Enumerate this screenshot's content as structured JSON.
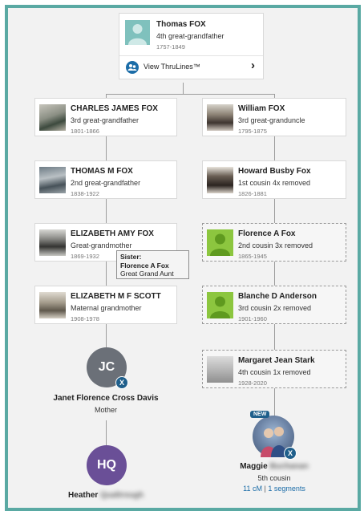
{
  "top": {
    "name": "Thomas FOX",
    "relation": "4th great-grandfather",
    "dates": "1757-1849",
    "thrulines_label": "View ThruLines™",
    "chevron": "›"
  },
  "left": [
    {
      "name": "CHARLES JAMES FOX",
      "relation": "3rd great-grandfather",
      "dates": "1801-1866"
    },
    {
      "name": "THOMAS M FOX",
      "relation": "2nd great-grandfather",
      "dates": "1838-1922"
    },
    {
      "name": "ELIZABETH AMY FOX",
      "relation": "Great-grandmother",
      "dates": "1869-1932"
    },
    {
      "name": "ELIZABETH M F SCOTT",
      "relation": "Maternal grandmother",
      "dates": "1908-1978"
    }
  ],
  "right": [
    {
      "name": "William FOX",
      "relation": "3rd great-granduncle",
      "dates": "1795-1875"
    },
    {
      "name": "Howard Busby Fox",
      "relation": "1st cousin 4x removed",
      "dates": "1826-1881"
    },
    {
      "name": "Florence A Fox",
      "relation": "2nd cousin 3x removed",
      "dates": "1865-1945"
    },
    {
      "name": "Blanche D Anderson",
      "relation": "3rd cousin 2x removed",
      "dates": "1901-1960"
    },
    {
      "name": "Margaret Jean Stark",
      "relation": "4th cousin 1x removed",
      "dates": "1928-2020"
    }
  ],
  "sister_tooltip": {
    "title": "Sister:",
    "name": "Florence A Fox",
    "relation": "Great Grand Aunt"
  },
  "mother": {
    "initials": "JC",
    "name": "Janet Florence Cross Davis",
    "relation": "Mother",
    "color": "#6b7078"
  },
  "self": {
    "initials": "HQ",
    "first_name": "Heather",
    "surname": "Qualtrough",
    "color": "#6a4f97"
  },
  "match": {
    "badge": "NEW",
    "first_name": "Maggie",
    "surname": "Buchanan",
    "relation": "5th cousin",
    "cm": "11 cM",
    "separator": "|",
    "segments": "1 segments"
  },
  "dna_badge": "X",
  "colors": {
    "frame": "#5aa9a3",
    "silhouette": "#8cc63f",
    "link": "#1c6da8",
    "badge": "#1f5f8b"
  }
}
